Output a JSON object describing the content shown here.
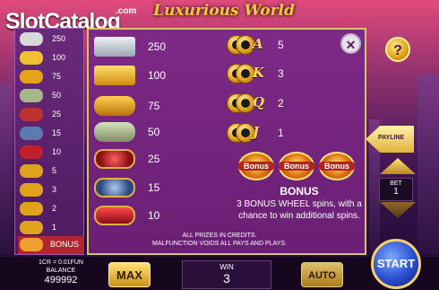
{
  "header": {
    "logo_main": "SlotCatalog",
    "logo_suffix": ".com",
    "title": "Luxurious World"
  },
  "left_paytable": [
    {
      "value": "250"
    },
    {
      "value": "100"
    },
    {
      "value": "75"
    },
    {
      "value": "50"
    },
    {
      "value": "25"
    },
    {
      "value": "15"
    },
    {
      "value": "10"
    },
    {
      "value": "5"
    },
    {
      "value": "3"
    },
    {
      "value": "2"
    },
    {
      "value": "1"
    },
    {
      "value": "BONUS"
    }
  ],
  "paytable": {
    "premium": [
      {
        "symbol": "mansion-icon",
        "value": "250"
      },
      {
        "symbol": "sports-car-icon",
        "value": "100"
      },
      {
        "symbol": "gold-bars-icon",
        "value": "75"
      },
      {
        "symbol": "cash-stack-icon",
        "value": "50"
      },
      {
        "symbol": "ruby-rings-icon",
        "value": "25"
      },
      {
        "symbol": "watch-icon",
        "value": "15"
      },
      {
        "symbol": "red-shoes-icon",
        "value": "10"
      }
    ],
    "low": [
      {
        "letter": "A",
        "value": "5"
      },
      {
        "letter": "K",
        "value": "3"
      },
      {
        "letter": "Q",
        "value": "2"
      },
      {
        "letter": "J",
        "value": "1"
      }
    ],
    "bonus_symbol_label": "Bonus",
    "bonus_title": "BONUS",
    "bonus_desc": "3 BONUS WHEEL spins, with a chance to win additional spins.",
    "fine_print_1": "ALL PRIZES IN CREDITS.",
    "fine_print_2": "MALFUNCTION VOIDS ALL PAYS AND PLAYS."
  },
  "right_panel": {
    "help": "?",
    "payline_label": "PAYLINE",
    "bet_label": "BET",
    "bet_value": "1"
  },
  "bottom": {
    "denomination": "1CR = 0.01FUN",
    "balance_label": "BALANCE",
    "balance_value": "499992",
    "max_label": "MAX",
    "win_label": "WIN",
    "win_value": "3",
    "auto_label": "AUTO",
    "start_label": "START"
  },
  "colors": {
    "gold": "#f6c342",
    "panel": "#7d2a86",
    "bonus_red": "#b0252e",
    "start_blue": "#2a4fd0"
  }
}
